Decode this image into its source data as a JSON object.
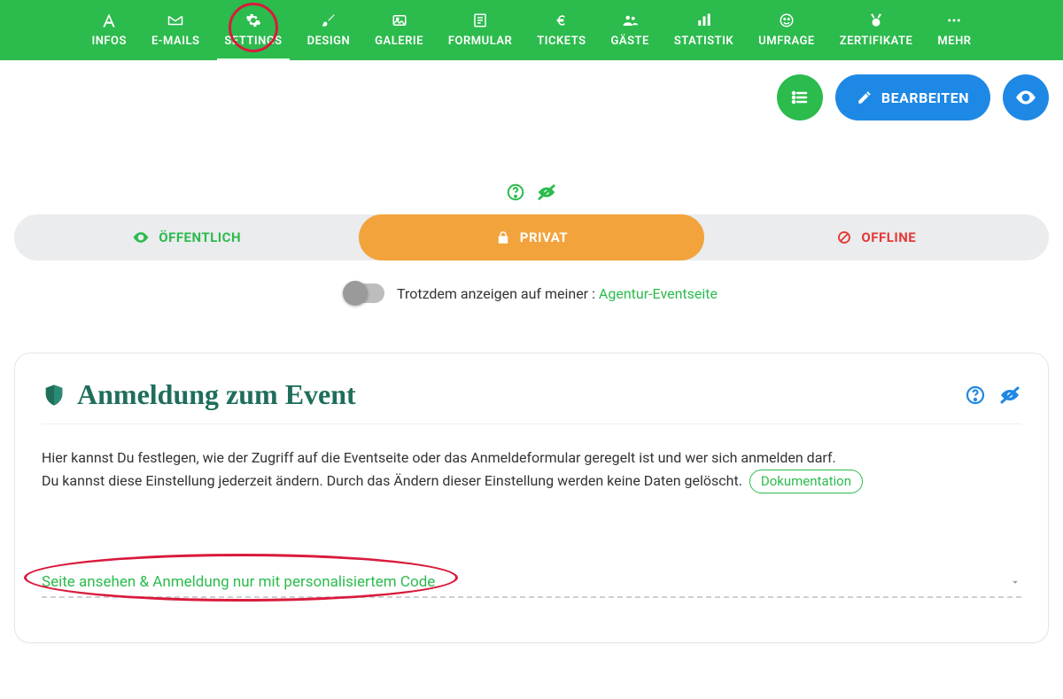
{
  "nav": {
    "items": [
      {
        "label": "INFOS",
        "icon": "font-a"
      },
      {
        "label": "E-MAILS",
        "icon": "envelope"
      },
      {
        "label": "SETTINGS",
        "icon": "gear",
        "active": true,
        "highlighted": true
      },
      {
        "label": "DESIGN",
        "icon": "brush"
      },
      {
        "label": "GALERIE",
        "icon": "image"
      },
      {
        "label": "FORMULAR",
        "icon": "form"
      },
      {
        "label": "TICKETS",
        "icon": "euro"
      },
      {
        "label": "GÄSTE",
        "icon": "users"
      },
      {
        "label": "STATISTIK",
        "icon": "bars"
      },
      {
        "label": "UMFRAGE",
        "icon": "smile"
      },
      {
        "label": "ZERTIFIKATE",
        "icon": "medal"
      },
      {
        "label": "MEHR",
        "icon": "dots"
      }
    ]
  },
  "actions": {
    "edit_label": "BEARBEITEN"
  },
  "visibility": {
    "public_label": "ÖFFENTLICH",
    "private_label": "PRIVAT",
    "offline_label": "OFFLINE"
  },
  "toggle": {
    "prefix": "Trotzdem anzeigen auf meiner :",
    "link": "Agentur-Eventseite",
    "on": false
  },
  "card": {
    "title": "Anmeldung zum Event",
    "desc_line1": "Hier kannst Du festlegen, wie der Zugriff auf die Eventseite oder das Anmeldeformular geregelt ist und wer sich anmelden darf.",
    "desc_line2": "Du kannst diese Einstellung jederzeit ändern. Durch das Ändern dieser Einstellung werden keine Daten gelöscht.",
    "doc_label": "Dokumentation",
    "select_value": "Seite ansehen & Anmeldung nur mit personalisiertem Code"
  },
  "colors": {
    "green": "#2CBB4D",
    "orange": "#F2A33C",
    "blue": "#1E88E5",
    "red": "#E53935",
    "annot": "#D91A3C",
    "teal_title": "#1F6E5C"
  }
}
